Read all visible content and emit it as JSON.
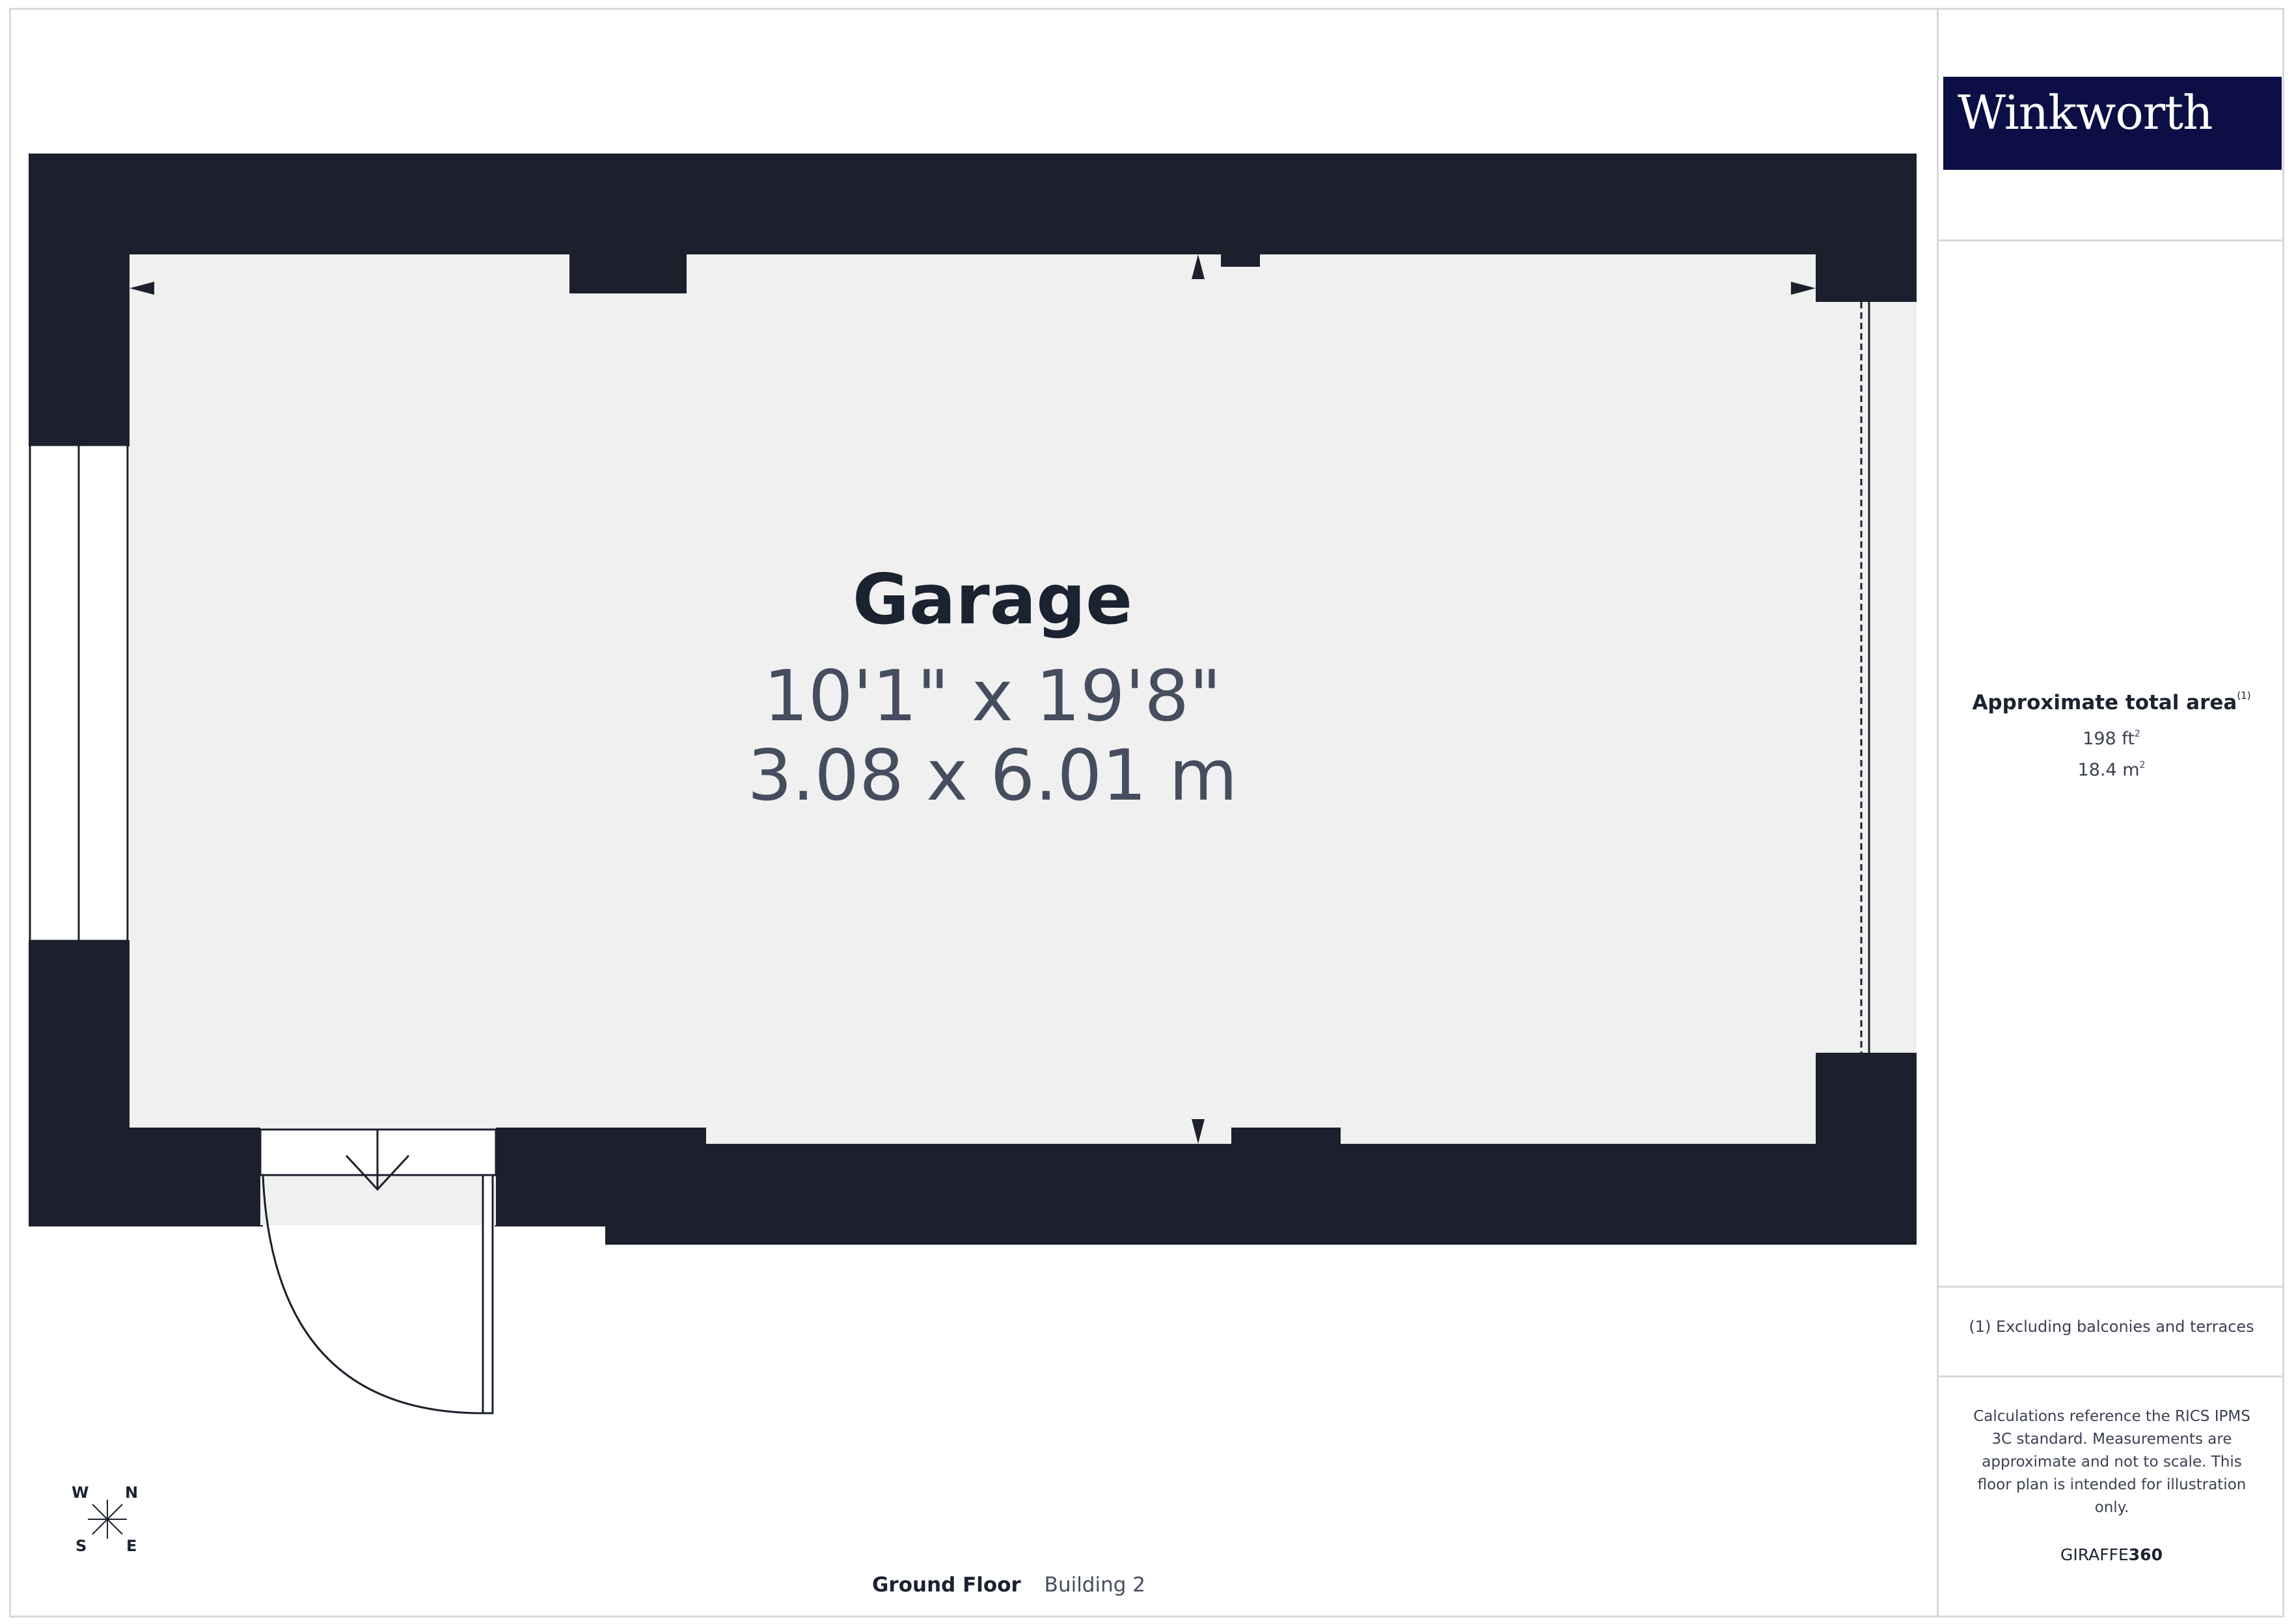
{
  "brand": {
    "logo_text": "Winkworth",
    "software_prefix": "GIRAFFE",
    "software_suffix": "360"
  },
  "room": {
    "name": "Garage",
    "dim_imperial": "10'1\" x 19'8\"",
    "dim_metric": "3.08 x 6.01 m"
  },
  "floor": {
    "level": "Ground Floor",
    "building": "Building 2"
  },
  "area": {
    "title": "Approximate total area",
    "footnote_mark": "(1)",
    "sqft": "198 ft",
    "sqm": "18.4 m",
    "unit_exp": "2"
  },
  "note": "(1) Excluding balconies and terraces",
  "disclaimer": "Calculations reference the RICS IPMS 3C standard. Measurements are approximate and not to scale. This floor plan is intended for illustration only.",
  "compass": {
    "n": "N",
    "e": "E",
    "s": "S",
    "w": "W"
  },
  "colors": {
    "wall": "#1b202c",
    "floor": "#f0f0f0",
    "brand_bg": "#0b0f45",
    "text": "#1b2230",
    "subtext": "#454d5e"
  }
}
